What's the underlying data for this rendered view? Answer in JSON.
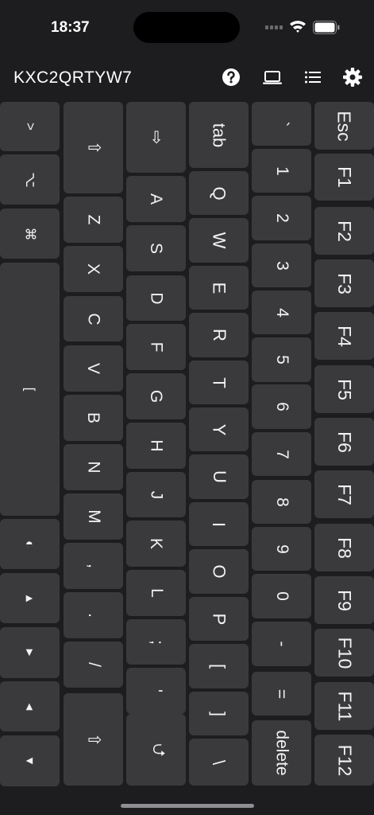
{
  "status_bar": {
    "time": "18:37"
  },
  "toolbar": {
    "device_code": "KXC2QRTYW7",
    "help_icon": "question-circle-icon",
    "laptop_icon": "laptop-icon",
    "list_icon": "list-icon",
    "settings_icon": "gear-icon"
  },
  "keyboard": {
    "col_fn": [
      "Esc",
      "F1",
      "F2",
      "F3",
      "F4",
      "F5",
      "F6",
      "F7",
      "F8",
      "F9",
      "F10",
      "F11",
      "F12"
    ],
    "col_num": [
      "`",
      "1",
      "2",
      "3",
      "4",
      "5",
      "6",
      "7",
      "8",
      "9",
      "0",
      "-",
      "=",
      "delete"
    ],
    "col_q": [
      "tab",
      "Q",
      "W",
      "E",
      "R",
      "T",
      "Y",
      "U",
      "I",
      "O",
      "P",
      "[",
      "]",
      "\\"
    ],
    "col_a": [
      "⇨",
      "A",
      "S",
      "D",
      "F",
      "G",
      "H",
      "J",
      "K",
      "L",
      ";",
      "'",
      "⮍"
    ],
    "col_z": [
      "⇧",
      "Z",
      "X",
      "C",
      "V",
      "B",
      "N",
      "M",
      ",",
      ".",
      "/",
      "⇧"
    ],
    "col_mod": [
      ">",
      "⌥",
      "⌘",
      "[",
      "◐",
      "▴",
      "▸",
      "◂",
      "▾"
    ]
  },
  "colors": {
    "background": "#1d1d1f",
    "key": "#3a3a3c",
    "text": "#ffffff"
  }
}
